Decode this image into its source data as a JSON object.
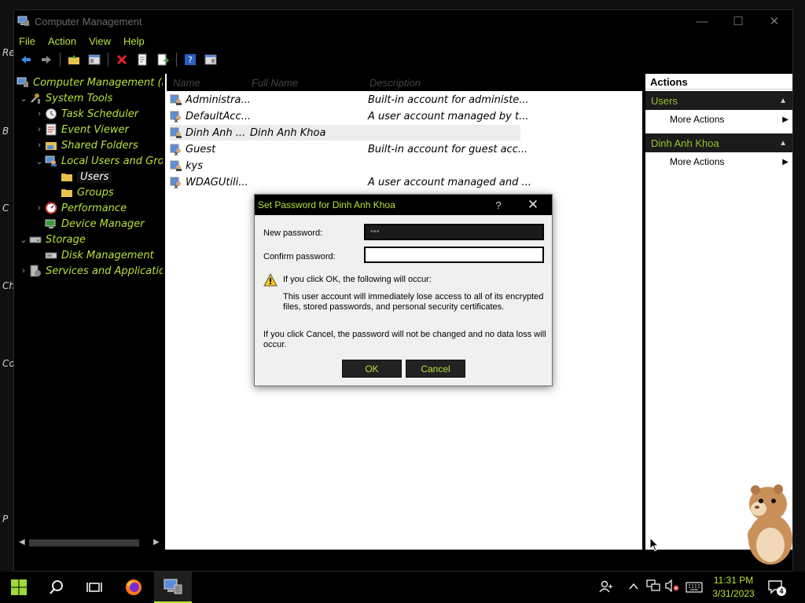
{
  "desktop_fragments": [
    "Re",
    "B",
    "C",
    "Ch",
    "Co",
    "P"
  ],
  "window": {
    "title": "Computer Management",
    "controls": {
      "minimize": "—",
      "maximize": "☐",
      "close": "✕"
    }
  },
  "menu": [
    "File",
    "Action",
    "View",
    "Help"
  ],
  "tree": [
    {
      "label": "Computer Management (Lo",
      "exp": "",
      "icon": "computer-mgmt-icon"
    },
    {
      "label": "System Tools",
      "exp": "⌄",
      "icon": "tools-icon"
    },
    {
      "label": "Task Scheduler",
      "exp": "›",
      "icon": "clock-icon"
    },
    {
      "label": "Event Viewer",
      "exp": "›",
      "icon": "event-viewer-icon"
    },
    {
      "label": "Shared Folders",
      "exp": "›",
      "icon": "shared-folder-icon"
    },
    {
      "label": "Local Users and Grou",
      "exp": "⌄",
      "icon": "users-group-icon"
    },
    {
      "label": "Users",
      "exp": "",
      "icon": "folder-icon"
    },
    {
      "label": "Groups",
      "exp": "",
      "icon": "folder-icon"
    },
    {
      "label": "Performance",
      "exp": "›",
      "icon": "performance-icon"
    },
    {
      "label": "Device Manager",
      "exp": "",
      "icon": "device-manager-icon"
    },
    {
      "label": "Storage",
      "exp": "⌄",
      "icon": "storage-icon"
    },
    {
      "label": "Disk Management",
      "exp": "",
      "icon": "disk-icon"
    },
    {
      "label": "Services and Applicatior",
      "exp": "›",
      "icon": "services-icon"
    }
  ],
  "list": {
    "columns": [
      "Name",
      "Full Name",
      "Description"
    ],
    "rows": [
      {
        "name": "Administra...",
        "full": "",
        "desc": "Built-in account for administe..."
      },
      {
        "name": "DefaultAcc...",
        "full": "",
        "desc": "A user account managed by t..."
      },
      {
        "name": "Dinh Anh ...",
        "full": "Dinh Anh Khoa",
        "desc": ""
      },
      {
        "name": "Guest",
        "full": "",
        "desc": "Built-in account for guest acc..."
      },
      {
        "name": "kys",
        "full": "",
        "desc": ""
      },
      {
        "name": "WDAGUtili...",
        "full": "",
        "desc": "A user account managed and ..."
      }
    ]
  },
  "actions": {
    "header": "Actions",
    "sections": [
      {
        "title": "Users",
        "items": [
          "More Actions"
        ]
      },
      {
        "title": "Dinh Anh Khoa",
        "items": [
          "More Actions"
        ]
      }
    ]
  },
  "dialog": {
    "title": "Set Password for Dinh Anh Khoa",
    "help": "?",
    "close": "✕",
    "new_password_label": "New password:",
    "new_password_value": "•••",
    "confirm_password_label": "Confirm password:",
    "confirm_password_value": "",
    "warning_heading": "If you click OK, the following will occur:",
    "warning_line1": "This user account will immediately lose access to all of its encrypted",
    "warning_line2": "files, stored passwords, and personal security certificates.",
    "cancel_line1": "If you click Cancel, the password will not be changed and no data loss will",
    "cancel_line2": "occur.",
    "ok_label": "OK",
    "cancel_label": "Cancel"
  },
  "taskbar": {
    "time": "11:31 PM",
    "date": "3/31/2023",
    "notification_count": "4"
  },
  "colors": {
    "accent": "#b9e33b",
    "bg": "#000000",
    "dialog_bg": "#f0f0f0"
  }
}
